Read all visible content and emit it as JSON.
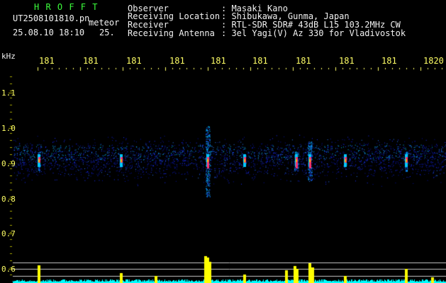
{
  "header": {
    "brand": "H R O F F T",
    "filename": "UT2508101810.pn",
    "mode": "meteor",
    "datetime": "25.08.10 18:10",
    "extra": "25.",
    "fields": [
      {
        "label": "Observer",
        "value": ": Masaki Kano"
      },
      {
        "label": "Receiving Location",
        "value": ": Shibukawa, Gunma, Japan"
      },
      {
        "label": "Receiver",
        "value": ": RTL-SDR SDR# 43dB L15 103.2MHz CW"
      },
      {
        "label": "Receiving Antenna",
        "value": ": 3el Yagi(V) Az 330 for Vladivostok"
      }
    ]
  },
  "axis": {
    "unit": "kHz",
    "time_ticks": [
      "181",
      "181",
      "181",
      "181",
      "181",
      "181",
      "181",
      "181",
      "181",
      "1820"
    ],
    "freq_ticks": [
      "1.1",
      "1.0",
      "0.9",
      "0.8",
      "0.7",
      "0.6"
    ]
  },
  "colors": {
    "header_brand": "#3cff3c",
    "header_text": "#f2f2f2",
    "tick_labels": "#ffff66",
    "signal_core": "#ff3070",
    "signal_mid": "#00c8ff",
    "noise": "#1a2dff",
    "bar_peak": "#ffff00",
    "baseline": "#00ffff"
  }
}
